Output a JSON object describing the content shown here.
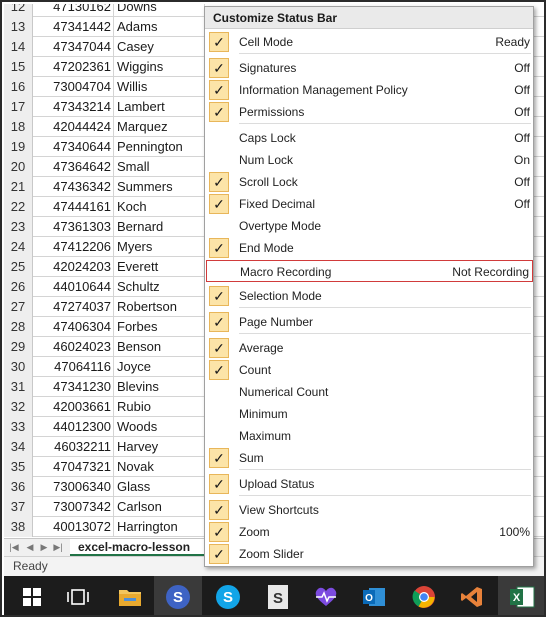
{
  "sheet": {
    "rows": [
      {
        "n": "12",
        "id": "47130162",
        "name": "Downs"
      },
      {
        "n": "13",
        "id": "47341442",
        "name": "Adams"
      },
      {
        "n": "14",
        "id": "47347044",
        "name": "Casey"
      },
      {
        "n": "15",
        "id": "47202361",
        "name": "Wiggins"
      },
      {
        "n": "16",
        "id": "73004704",
        "name": "Willis"
      },
      {
        "n": "17",
        "id": "47343214",
        "name": "Lambert"
      },
      {
        "n": "18",
        "id": "42044424",
        "name": "Marquez"
      },
      {
        "n": "19",
        "id": "47340644",
        "name": "Pennington"
      },
      {
        "n": "20",
        "id": "47364642",
        "name": "Small"
      },
      {
        "n": "21",
        "id": "47436342",
        "name": "Summers"
      },
      {
        "n": "22",
        "id": "47444161",
        "name": "Koch"
      },
      {
        "n": "23",
        "id": "47361303",
        "name": "Bernard"
      },
      {
        "n": "24",
        "id": "47412206",
        "name": "Myers"
      },
      {
        "n": "25",
        "id": "42024203",
        "name": "Everett"
      },
      {
        "n": "26",
        "id": "44010644",
        "name": "Schultz"
      },
      {
        "n": "27",
        "id": "47274037",
        "name": "Robertson"
      },
      {
        "n": "28",
        "id": "47406304",
        "name": "Forbes"
      },
      {
        "n": "29",
        "id": "46024023",
        "name": "Benson"
      },
      {
        "n": "30",
        "id": "47064116",
        "name": "Joyce"
      },
      {
        "n": "31",
        "id": "47341230",
        "name": "Blevins"
      },
      {
        "n": "32",
        "id": "42003661",
        "name": "Rubio"
      },
      {
        "n": "33",
        "id": "44012300",
        "name": "Woods"
      },
      {
        "n": "34",
        "id": "46032211",
        "name": "Harvey"
      },
      {
        "n": "35",
        "id": "47047321",
        "name": "Novak"
      },
      {
        "n": "36",
        "id": "73006340",
        "name": "Glass"
      },
      {
        "n": "37",
        "id": "73007342",
        "name": "Carlson"
      },
      {
        "n": "38",
        "id": "40013072",
        "name": "Harrington"
      }
    ]
  },
  "tabs": {
    "sheet_name": "excel-macro-lesson"
  },
  "status": {
    "text": "Ready"
  },
  "menu": {
    "title": "Customize Status Bar",
    "items": [
      {
        "label": "Cell Mode",
        "value": "Ready",
        "checked": true
      },
      {
        "label": "Signatures",
        "value": "Off",
        "checked": true
      },
      {
        "label": "Information Management Policy",
        "value": "Off",
        "checked": true
      },
      {
        "label": "Permissions",
        "value": "Off",
        "checked": true
      },
      {
        "label": "Caps Lock",
        "value": "Off",
        "checked": false
      },
      {
        "label": "Num Lock",
        "value": "On",
        "checked": false
      },
      {
        "label": "Scroll Lock",
        "value": "Off",
        "checked": true
      },
      {
        "label": "Fixed Decimal",
        "value": "Off",
        "checked": true
      },
      {
        "label": "Overtype Mode",
        "value": "",
        "checked": false
      },
      {
        "label": "End Mode",
        "value": "",
        "checked": true
      },
      {
        "label": "Macro Recording",
        "value": "Not Recording",
        "checked": false
      },
      {
        "label": "Selection Mode",
        "value": "",
        "checked": true
      },
      {
        "label": "Page Number",
        "value": "",
        "checked": true
      },
      {
        "label": "Average",
        "value": "",
        "checked": true
      },
      {
        "label": "Count",
        "value": "",
        "checked": true
      },
      {
        "label": "Numerical Count",
        "value": "",
        "checked": false
      },
      {
        "label": "Minimum",
        "value": "",
        "checked": false
      },
      {
        "label": "Maximum",
        "value": "",
        "checked": false
      },
      {
        "label": "Sum",
        "value": "",
        "checked": true
      },
      {
        "label": "Upload Status",
        "value": "",
        "checked": true
      },
      {
        "label": "View Shortcuts",
        "value": "",
        "checked": true
      },
      {
        "label": "Zoom",
        "value": "100%",
        "checked": true
      },
      {
        "label": "Zoom Slider",
        "value": "",
        "checked": true
      }
    ],
    "check_glyph": "✓"
  },
  "taskbar": {
    "icons": [
      "windows-start-icon",
      "task-view-icon",
      "file-explorer-icon",
      "skype-business-icon",
      "skype-icon",
      "sway-icon",
      "health-app-icon",
      "outlook-icon",
      "chrome-icon",
      "visual-studio-icon",
      "excel-icon"
    ]
  },
  "colors": {
    "check_bg": "#fce4a8",
    "highlight_border": "#d13b3b",
    "excel_green": "#217346",
    "taskbar": "#1c1c1c"
  }
}
